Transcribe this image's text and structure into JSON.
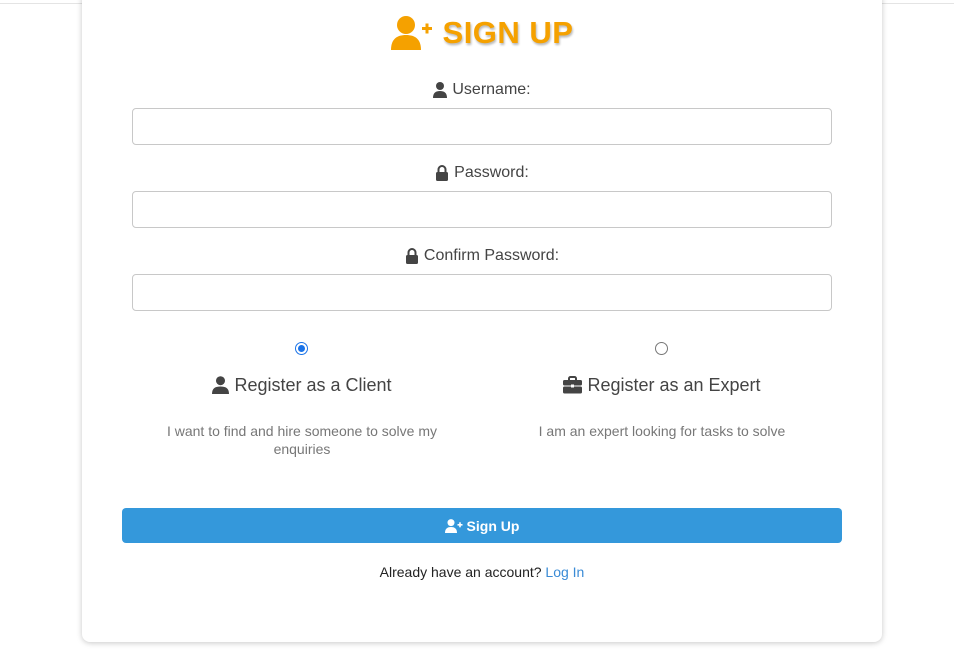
{
  "title": "SIGN UP",
  "fields": {
    "username": {
      "label": "Username:",
      "value": "",
      "placeholder": ""
    },
    "password": {
      "label": "Password:",
      "value": "",
      "placeholder": ""
    },
    "confirm_password": {
      "label": "Confirm Password:",
      "value": "",
      "placeholder": ""
    }
  },
  "roles": {
    "client": {
      "title": "Register as a Client",
      "description": "I want to find and hire someone to solve my enquiries",
      "selected": true,
      "icon": "user-icon"
    },
    "expert": {
      "title": "Register as an Expert",
      "description": "I am an expert looking for tasks to solve",
      "selected": false,
      "icon": "briefcase-icon"
    }
  },
  "signup_button": {
    "label": "Sign Up",
    "icon": "user-plus-icon"
  },
  "login": {
    "prompt": "Already have an account?",
    "link": "Log In"
  },
  "colors": {
    "title": "#f5a100",
    "button": "#3498db",
    "link": "#3a8bd6",
    "radio_selected": "#1a73e8"
  }
}
